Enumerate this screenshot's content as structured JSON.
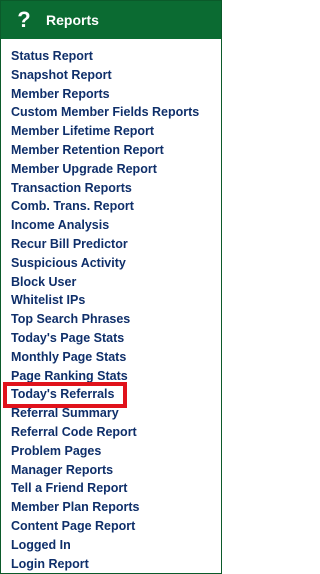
{
  "header": {
    "icon": "help-icon",
    "title": "Reports"
  },
  "menu": {
    "items": [
      "Status Report",
      "Snapshot Report",
      "Member Reports",
      "Custom Member Fields Reports",
      "Member Lifetime Report",
      "Member Retention Report",
      "Member Upgrade Report",
      "Transaction Reports",
      "Comb. Trans. Report",
      "Income Analysis",
      "Recur Bill Predictor",
      "Suspicious Activity",
      "Block User",
      "Whitelist IPs",
      "Top Search Phrases",
      "Today's Page Stats",
      "Monthly Page Stats",
      "Page Ranking Stats",
      "Today's Referrals",
      "Referral Summary",
      "Referral Code Report",
      "Problem Pages",
      "Manager Reports",
      "Tell a Friend Report",
      "Member Plan Reports",
      "Content Page Report",
      "Logged In",
      "Login Report"
    ]
  },
  "colors": {
    "header": "#0b6b32",
    "link": "#0f2f6a",
    "highlight": "#e0121b"
  }
}
